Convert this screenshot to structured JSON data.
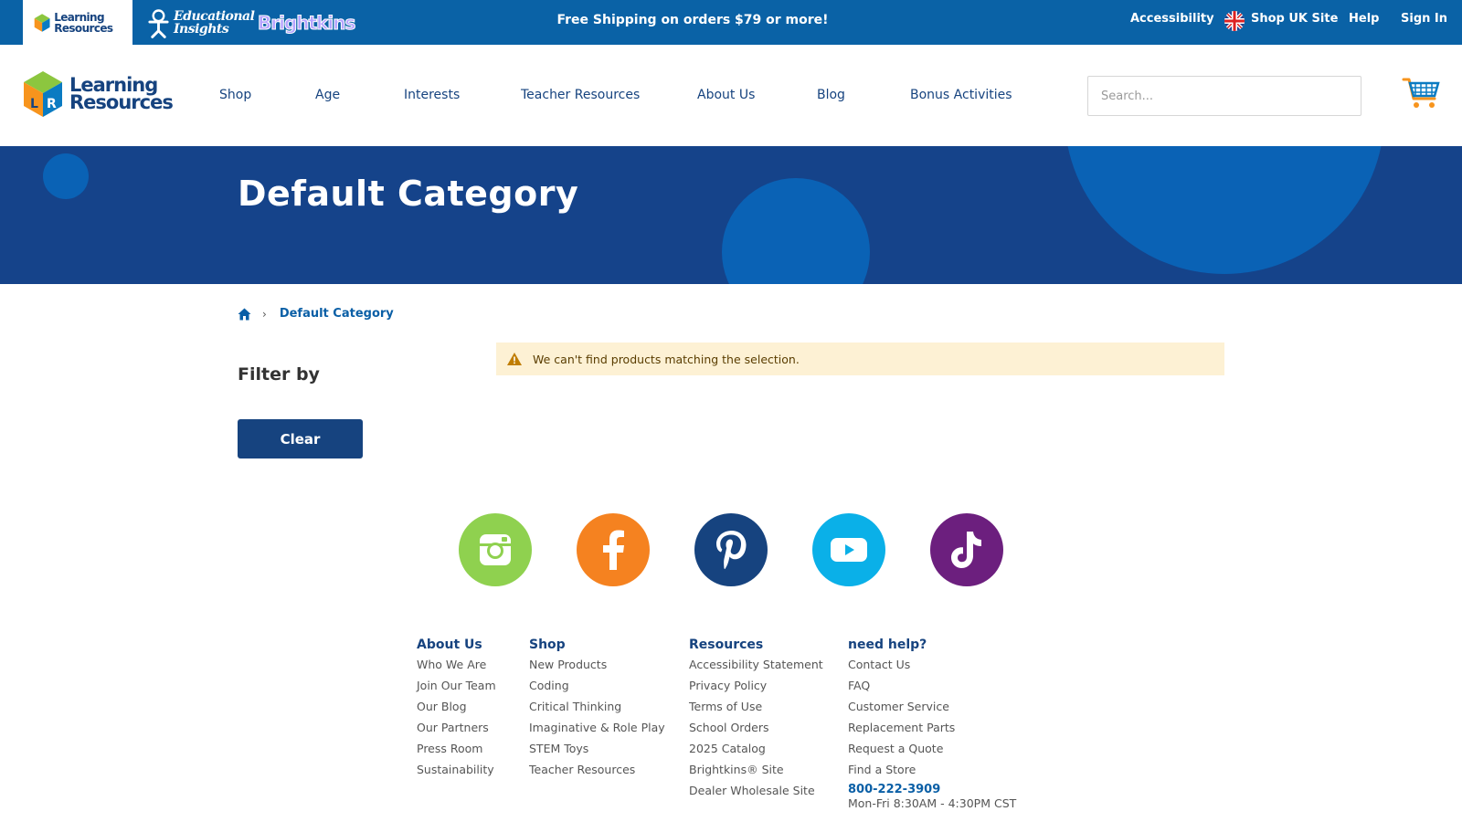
{
  "topbar": {
    "brands": [
      "Learning Resources",
      "Educational Insights",
      "Brightkins"
    ],
    "promo": "Free Shipping on orders $79 or more!",
    "accessibility": "Accessibility",
    "shop_uk": "Shop UK Site",
    "help": "Help",
    "sign_in": "Sign In",
    "bg_color": "#0a62a6"
  },
  "header": {
    "logo_line1": "Learning",
    "logo_line2": "Resources",
    "nav": [
      "Shop",
      "Age",
      "Interests",
      "Teacher Resources",
      "About Us",
      "Blog",
      "Bonus Activities"
    ],
    "search_placeholder": "Search..."
  },
  "hero": {
    "title": "Default Category",
    "bg_color": "#15438a",
    "bubble_color": "#0a62b5"
  },
  "breadcrumb": {
    "home_icon": "home-icon",
    "current": "Default Category"
  },
  "filters": {
    "title": "Filter by",
    "clear_label": "Clear"
  },
  "notice": {
    "icon": "warning-icon",
    "message": "We can't find products matching the selection.",
    "bg_color": "#fdf1d4"
  },
  "social": [
    {
      "name": "instagram",
      "color": "#8fd14f"
    },
    {
      "name": "facebook",
      "color": "#f58220"
    },
    {
      "name": "pinterest",
      "color": "#16437f"
    },
    {
      "name": "youtube",
      "color": "#0ab0e8"
    },
    {
      "name": "tiktok",
      "color": "#6c1f7e"
    }
  ],
  "footer": {
    "about": {
      "title": "About Us",
      "links": [
        "Who We Are",
        "Join Our Team",
        "Our Blog",
        "Our Partners",
        "Press Room",
        "Sustainability"
      ]
    },
    "shop": {
      "title": "Shop",
      "links": [
        "New Products",
        "Coding",
        "Critical Thinking",
        "Imaginative & Role Play",
        "STEM Toys",
        "Teacher Resources"
      ]
    },
    "resources": {
      "title": "Resources",
      "links": [
        "Accessibility Statement",
        "Privacy Policy",
        "Terms of Use",
        "School Orders",
        "2025 Catalog",
        "Brightkins® Site",
        "Dealer Wholesale Site"
      ]
    },
    "help": {
      "title": "need help?",
      "links": [
        "Contact Us",
        "FAQ",
        "Customer Service",
        "Replacement Parts",
        "Request a Quote",
        "Find a Store"
      ],
      "phone": "800-222-3909",
      "hours": "Mon-Fri 8:30AM - 4:30PM CST"
    }
  }
}
